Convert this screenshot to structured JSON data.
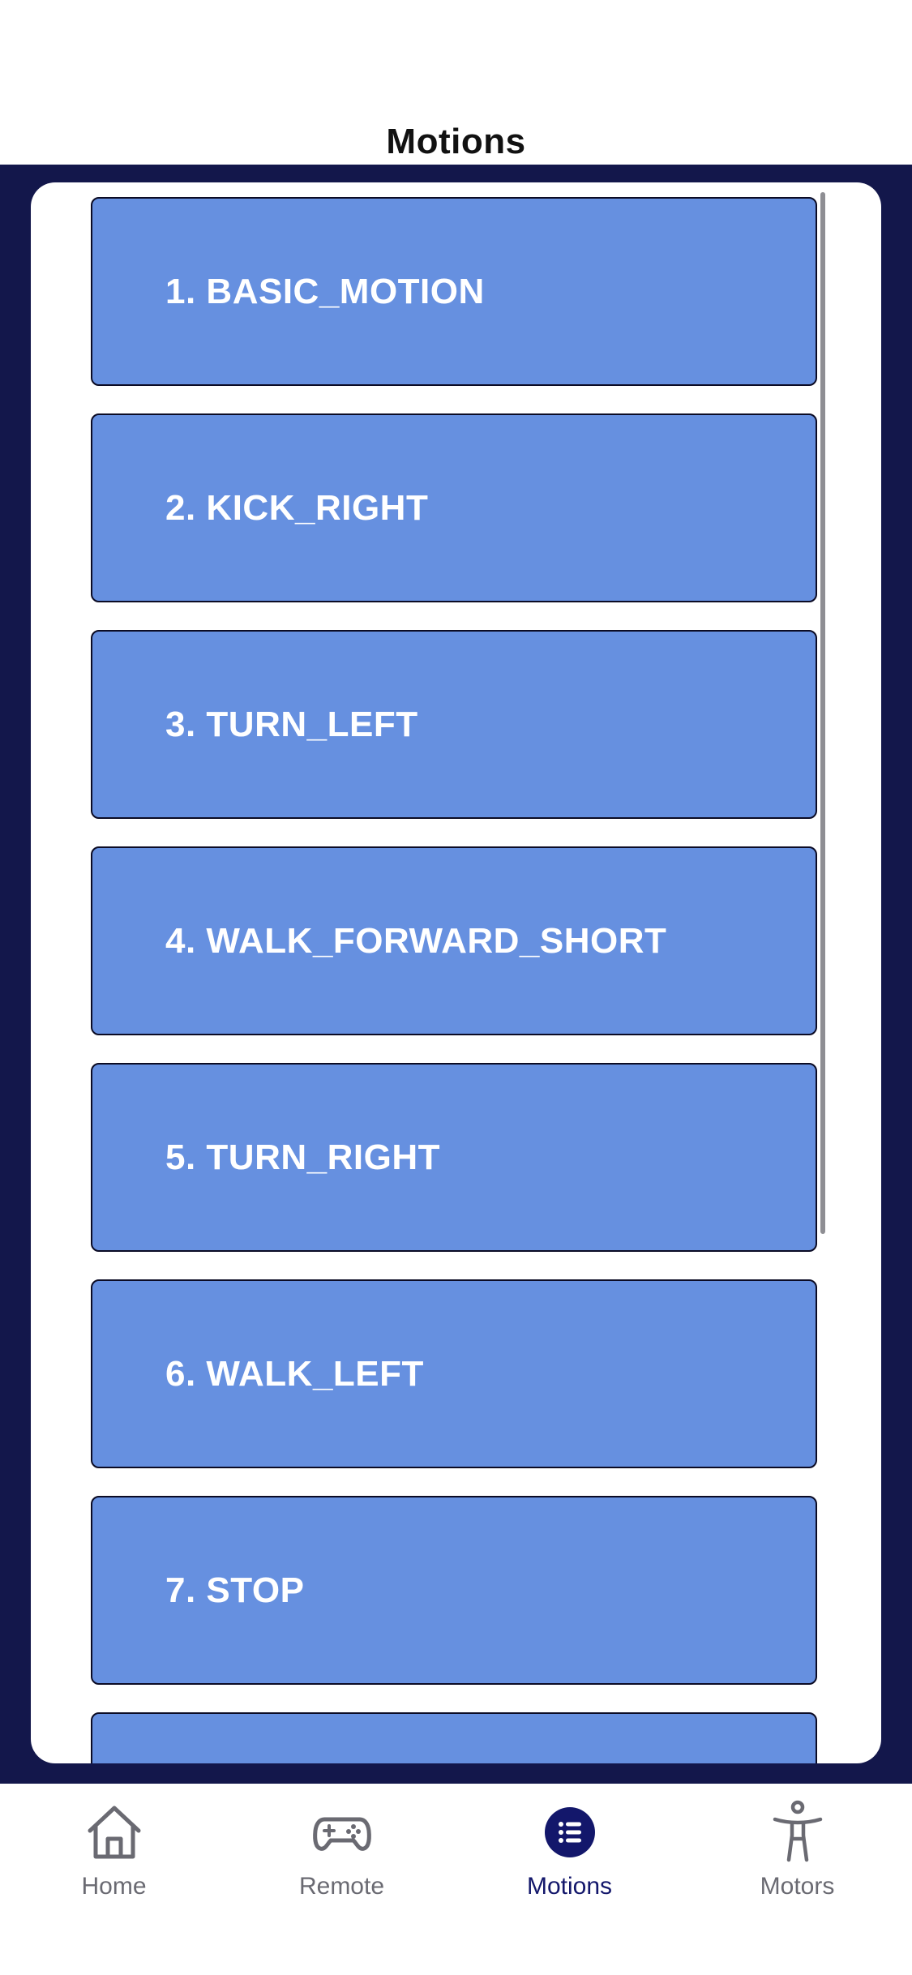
{
  "header": {
    "title": "Motions"
  },
  "motions": [
    {
      "label": "1. BASIC_MOTION"
    },
    {
      "label": "2. KICK_RIGHT"
    },
    {
      "label": "3. TURN_LEFT"
    },
    {
      "label": "4. WALK_FORWARD_SHORT"
    },
    {
      "label": "5. TURN_RIGHT"
    },
    {
      "label": "6. WALK_LEFT"
    },
    {
      "label": "7. STOP"
    },
    {
      "label": ""
    }
  ],
  "tabbar": {
    "tabs": [
      {
        "label": "Home",
        "icon": "home-icon"
      },
      {
        "label": "Remote",
        "icon": "gamepad-icon"
      },
      {
        "label": "Motions",
        "icon": "list-icon",
        "active": true
      },
      {
        "label": "Motors",
        "icon": "person-icon"
      }
    ]
  },
  "colors": {
    "navy": "#13174b",
    "button_blue": "#6690e0",
    "active_tab": "#13176b",
    "inactive_tab": "#6a6a72"
  }
}
